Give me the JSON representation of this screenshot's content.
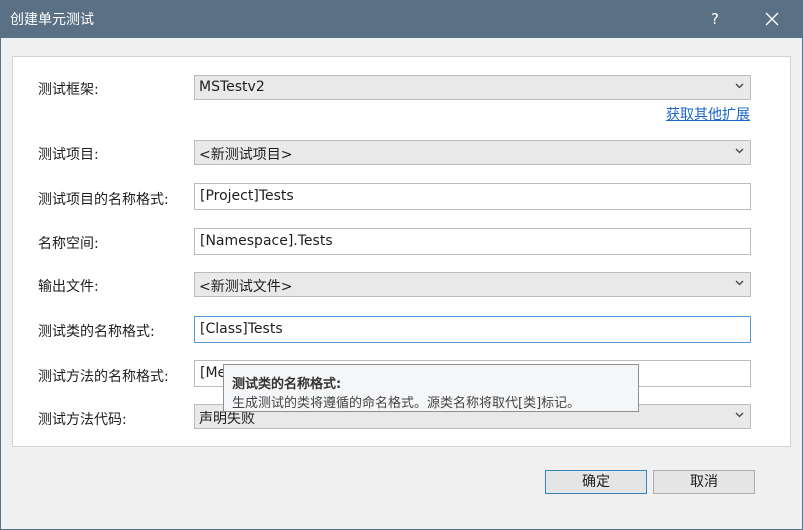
{
  "window": {
    "title": "创建单元测试",
    "help_label": "?",
    "close_icon": "close-icon"
  },
  "fields": {
    "test_framework": {
      "label": "测试框架:",
      "value": "MSTestv2"
    },
    "get_extensions_link": "获取其他扩展",
    "test_project": {
      "label": "测试项目:",
      "value": "<新测试项目>"
    },
    "test_project_name_format": {
      "label": "测试项目的名称格式:",
      "value": "[Project]Tests"
    },
    "namespace": {
      "label": "名称空间:",
      "value": "[Namespace].Tests"
    },
    "output_file": {
      "label": "输出文件:",
      "value": "<新测试文件>"
    },
    "test_class_name_format": {
      "label": "测试类的名称格式:",
      "value": "[Class]Tests"
    },
    "test_method_name_format": {
      "label": "测试方法的名称格式:",
      "value": "[Me"
    },
    "test_method_code": {
      "label": "测试方法代码:",
      "value": "声明失败"
    }
  },
  "tooltip": {
    "title": "测试类的名称格式:",
    "body": "生成测试的类将遵循的命名格式。源类名称将取代[类]标记。"
  },
  "buttons": {
    "ok": "确定",
    "cancel": "取消"
  },
  "colors": {
    "titlebar": "#5a7185",
    "link": "#1a66c9",
    "focus_border": "#5b9bd5"
  }
}
